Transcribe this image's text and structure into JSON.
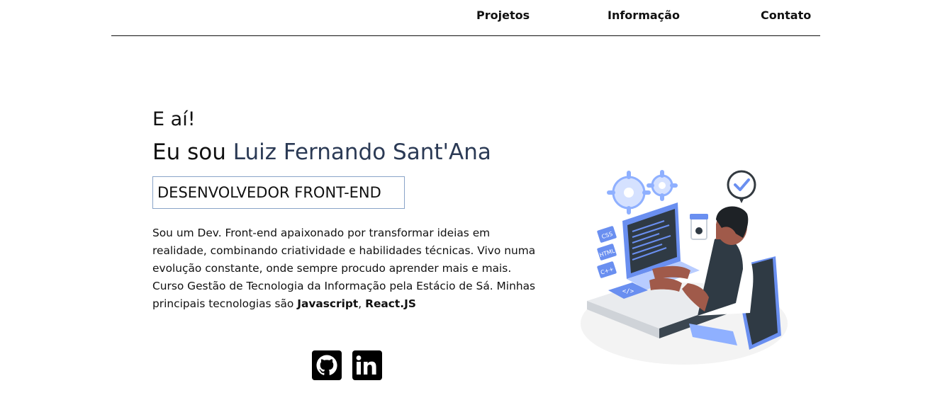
{
  "nav": {
    "items": [
      {
        "label": "Projetos"
      },
      {
        "label": "Informação"
      },
      {
        "label": "Contato"
      }
    ]
  },
  "hero": {
    "greeting": "E aí!",
    "intro_prefix": "Eu sou ",
    "name": "Luiz Fernando Sant'Ana",
    "role": "DESENVOLVEDOR FRONT-END",
    "description": "Sou um Dev. Front-end apaixonado por transformar ideias em realidade, combinando criatividade e habilidades técnicas. Vivo numa evolução constante, onde sempre procudo aprender mais e mais. Curso Gestão de Tecnologia da Informação pela Estácio de Sá. Minhas principais tecnologias são ",
    "tech_1": "Javascript",
    "separator": ", ",
    "tech_2": "React.JS"
  },
  "social": [
    {
      "icon": "github-icon"
    },
    {
      "icon": "linkedin-icon"
    }
  ],
  "illustration": {
    "labels": [
      "CSS",
      "HTML",
      "C++"
    ]
  },
  "colors": {
    "accent": "#2b3a55",
    "border": "#8aa4c8",
    "illustration_blue": "#6a8ff0"
  }
}
